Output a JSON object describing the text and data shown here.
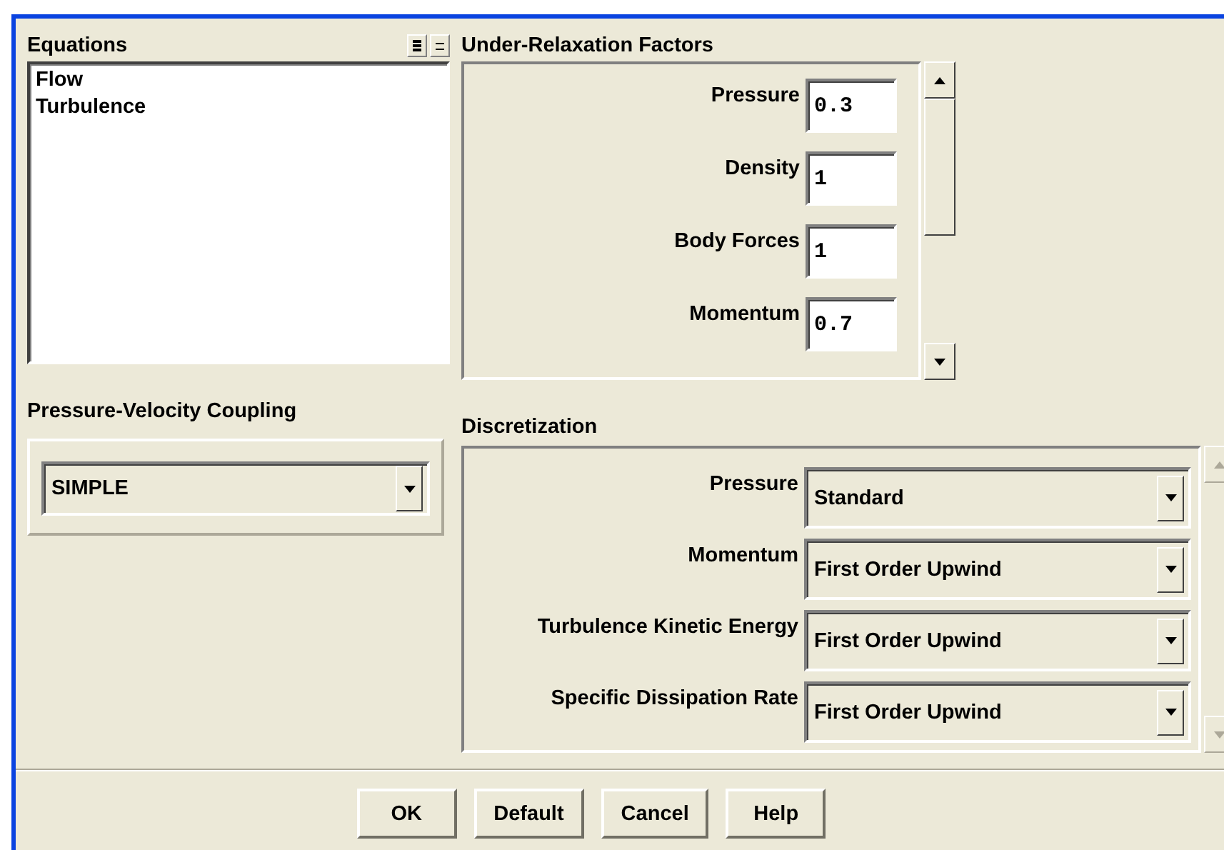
{
  "equations": {
    "label": "Equations",
    "items": [
      {
        "label": "Flow"
      },
      {
        "label": "Turbulence"
      }
    ]
  },
  "coupling": {
    "label": "Pressure-Velocity Coupling",
    "value": "SIMPLE"
  },
  "relaxation": {
    "label": "Under-Relaxation Factors",
    "rows": [
      {
        "label": "Pressure",
        "value": "0.3"
      },
      {
        "label": "Density",
        "value": "1"
      },
      {
        "label": "Body Forces",
        "value": "1"
      },
      {
        "label": "Momentum",
        "value": "0.7"
      }
    ]
  },
  "discretization": {
    "label": "Discretization",
    "rows": [
      {
        "label": "Pressure",
        "value": "Standard"
      },
      {
        "label": "Momentum",
        "value": "First Order Upwind"
      },
      {
        "label": "Turbulence Kinetic Energy",
        "value": "First Order Upwind"
      },
      {
        "label": "Specific Dissipation Rate",
        "value": "First Order Upwind"
      }
    ]
  },
  "buttons": [
    "OK",
    "Default",
    "Cancel",
    "Help"
  ]
}
